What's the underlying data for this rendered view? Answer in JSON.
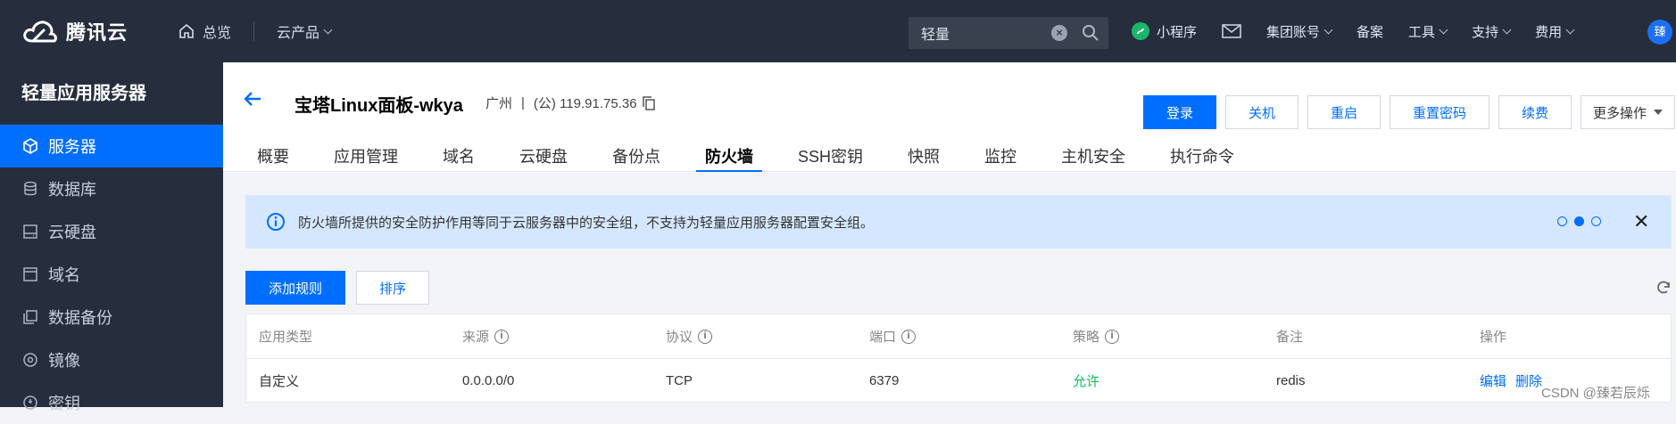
{
  "topbar": {
    "brand": "腾讯云",
    "overview": "总览",
    "products": "云产品",
    "search_value": "轻量",
    "mini_program": "小程序",
    "group_account": "集团账号",
    "filing": "备案",
    "tools": "工具",
    "support": "支持",
    "billing": "费用",
    "avatar": "臻"
  },
  "sidebar": {
    "title": "轻量应用服务器",
    "items": [
      {
        "label": "服务器",
        "icon": "cube-icon"
      },
      {
        "label": "数据库",
        "icon": "database-icon"
      },
      {
        "label": "云硬盘",
        "icon": "disk-icon"
      },
      {
        "label": "域名",
        "icon": "domain-icon"
      },
      {
        "label": "数据备份",
        "icon": "backup-icon"
      },
      {
        "label": "镜像",
        "icon": "image-icon"
      },
      {
        "label": "密钥",
        "icon": "key-icon"
      }
    ]
  },
  "instance": {
    "name": "宝塔Linux面板-wkya",
    "region": "广州",
    "sep": "|",
    "ip": "(公) 119.91.75.36"
  },
  "actions": {
    "login": "登录",
    "shutdown": "关机",
    "restart": "重启",
    "reset_pwd": "重置密码",
    "renew": "续费",
    "more": "更多操作"
  },
  "tabs": [
    "概要",
    "应用管理",
    "域名",
    "云硬盘",
    "备份点",
    "防火墙",
    "SSH密钥",
    "快照",
    "监控",
    "主机安全",
    "执行命令"
  ],
  "notice": {
    "text": "防火墙所提供的安全防护作用等同于云服务器中的安全组，不支持为轻量应用服务器配置安全组。",
    "close": "✕"
  },
  "toolbar": {
    "add_rule": "添加规则",
    "sort": "排序"
  },
  "table": {
    "headers": [
      "应用类型",
      "来源",
      "协议",
      "端口",
      "策略",
      "备注",
      "操作"
    ],
    "rows": [
      {
        "type": "自定义",
        "source": "0.0.0.0/0",
        "protocol": "TCP",
        "port": "6379",
        "policy": "允许",
        "note": "redis",
        "edit": "编辑",
        "delete": "删除"
      }
    ]
  },
  "watermark": "CSDN @臻若辰烁",
  "colors": {
    "accent": "#006eff",
    "topbar": "#262d3d",
    "notice_bg": "#d5e7ff",
    "allow": "#0abf5b"
  }
}
